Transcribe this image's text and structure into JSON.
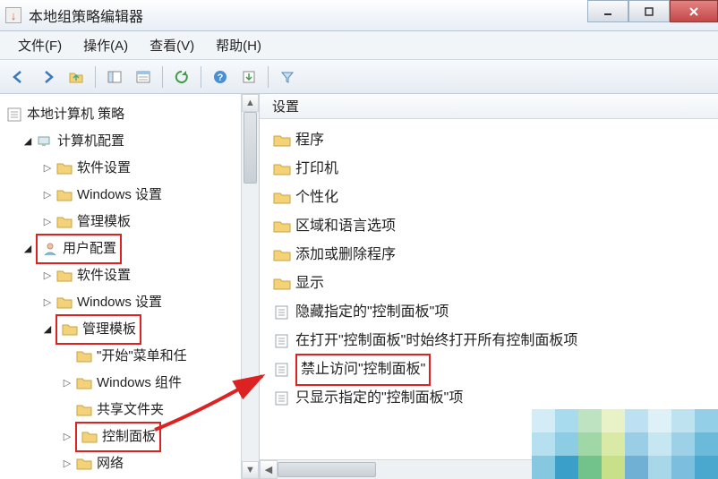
{
  "title": "本地组策略编辑器",
  "menu": {
    "file": "文件(F)",
    "action": "操作(A)",
    "view": "查看(V)",
    "help": "帮助(H)"
  },
  "tree": {
    "root": "本地计算机 策略",
    "computer_cfg": "计算机配置",
    "c_soft": "软件设置",
    "c_win": "Windows 设置",
    "c_admin": "管理模板",
    "user_cfg": "用户配置",
    "u_soft": "软件设置",
    "u_win": "Windows 设置",
    "u_admin": "管理模板",
    "start_menu": "\"开始\"菜单和任",
    "win_comp": "Windows 组件",
    "shared": "共享文件夹",
    "ctrlpanel": "控制面板",
    "network": "网络"
  },
  "list_header": "设置",
  "list": {
    "i0": "程序",
    "i1": "打印机",
    "i2": "个性化",
    "i3": "区域和语言选项",
    "i4": "添加或删除程序",
    "i5": "显示",
    "i6": "隐藏指定的\"控制面板\"项",
    "i7": "在打开\"控制面板\"时始终打开所有控制面板项",
    "i8": "禁止访问\"控制面板\"",
    "i9": "只显示指定的\"控制面板\"项"
  },
  "pixel_colors": [
    "#86c8e0",
    "#3aa0c9",
    "#72c28c",
    "#c9e08a",
    "#6fb0d4",
    "#a9d7ea"
  ]
}
